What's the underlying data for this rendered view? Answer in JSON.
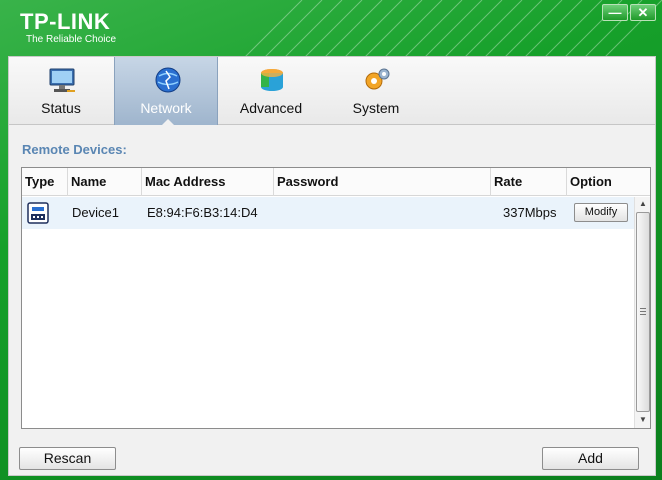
{
  "app": {
    "brand": "TP-LINK",
    "tagline": "The Reliable Choice",
    "minimize_label": "—",
    "close_label": "✕"
  },
  "tabs": [
    {
      "label": "Status",
      "icon": "monitor-icon",
      "active": false
    },
    {
      "label": "Network",
      "icon": "globe-icon",
      "active": true
    },
    {
      "label": "Advanced",
      "icon": "cube-icon",
      "active": false
    },
    {
      "label": "System",
      "icon": "gears-icon",
      "active": false
    }
  ],
  "section": {
    "title": "Remote Devices:"
  },
  "table": {
    "columns": [
      "Type",
      "Name",
      "Mac Address",
      "Password",
      "Rate",
      "Option"
    ],
    "rows": [
      {
        "type_icon": "powerline-adapter-icon",
        "name": "Device1",
        "mac": "E8:94:F6:B3:14:D4",
        "password": "",
        "rate": "337Mbps",
        "option_label": "Modify"
      }
    ]
  },
  "buttons": {
    "rescan": "Rescan",
    "add": "Add"
  },
  "colors": {
    "brand_green": "#1f9a2a",
    "section_title": "#5a86b3",
    "active_tab": "#9fb5cd",
    "selected_row": "#eaf3fb"
  }
}
